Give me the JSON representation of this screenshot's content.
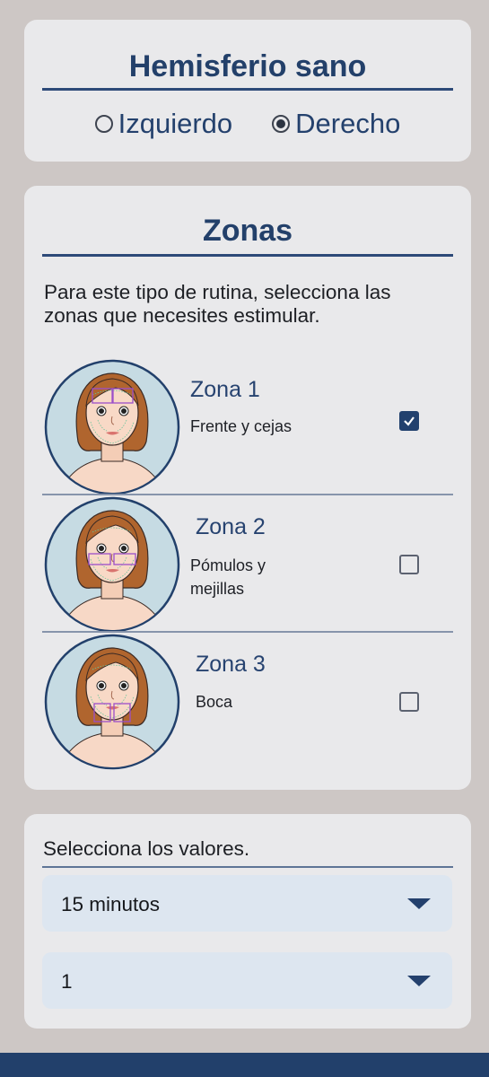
{
  "hemisphere": {
    "title": "Hemisferio sano",
    "options": [
      "Izquierdo",
      "Derecho"
    ],
    "selected": "Derecho"
  },
  "zones": {
    "title": "Zonas",
    "intro": "Para este tipo de rutina, selecciona las zonas que necesites estimular.",
    "items": [
      {
        "title": "Zona 1",
        "desc": "Frente y cejas",
        "checked": true
      },
      {
        "title": "Zona 2",
        "desc": "Pómulos y mejillas",
        "checked": false
      },
      {
        "title": "Zona 3",
        "desc": "Boca",
        "checked": false
      }
    ]
  },
  "values": {
    "label": "Selecciona los valores.",
    "duration": "15 minutos",
    "count": "1"
  },
  "colors": {
    "accent": "#22416e",
    "background": "#cdc7c5",
    "card": "#e9e9eb",
    "face_highlight": "#9b4fc9"
  }
}
